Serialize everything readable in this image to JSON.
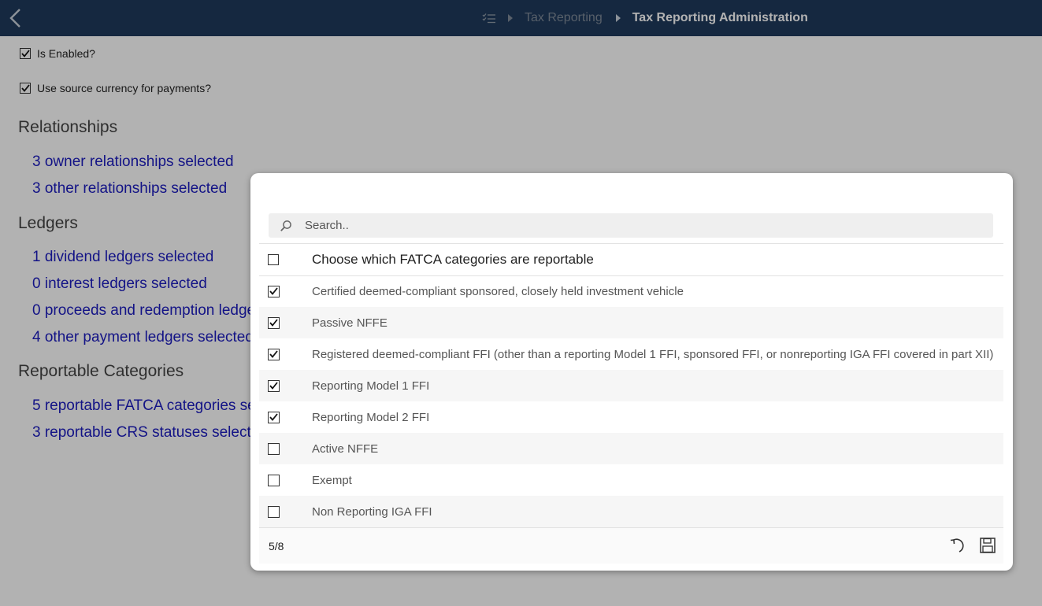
{
  "header": {
    "breadcrumb": [
      "Tax Reporting",
      "Tax Reporting Administration"
    ]
  },
  "settings": {
    "is_enabled": {
      "label": "Is Enabled?",
      "checked": true
    },
    "use_source_currency": {
      "label": "Use source currency for payments?",
      "checked": true
    }
  },
  "sections": {
    "relationships": {
      "title": "Relationships",
      "links": [
        "3 owner relationships selected",
        "3 other relationships selected"
      ]
    },
    "ledgers": {
      "title": "Ledgers",
      "links": [
        "1 dividend ledgers selected",
        "0 interest ledgers selected",
        "0 proceeds and redemption ledgers selected",
        "4 other payment ledgers selected"
      ]
    },
    "reportable_categories": {
      "title": "Reportable Categories",
      "links": [
        "5 reportable FATCA categories selected",
        "3 reportable CRS statuses selected"
      ]
    }
  },
  "modal": {
    "search_placeholder": "Search..",
    "header_label": "Choose which FATCA categories are reportable",
    "items": [
      {
        "label": "Certified deemed-compliant sponsored, closely held investment vehicle",
        "checked": true
      },
      {
        "label": "Passive NFFE",
        "checked": true
      },
      {
        "label": "Registered deemed-compliant FFI (other than a reporting Model 1 FFI, sponsored FFI, or nonreporting IGA FFI covered in part XII)",
        "checked": true
      },
      {
        "label": "Reporting Model 1 FFI",
        "checked": true
      },
      {
        "label": "Reporting Model 2 FFI",
        "checked": true
      },
      {
        "label": "Active NFFE",
        "checked": false
      },
      {
        "label": "Exempt",
        "checked": false
      },
      {
        "label": "Non Reporting IGA FFI",
        "checked": false
      }
    ],
    "count": "5/8"
  },
  "icons": {
    "back": "chevron-left-icon",
    "home": "checklist-icon",
    "search": "search-icon",
    "undo": "undo-icon",
    "save": "save-icon"
  },
  "colors": {
    "topbar": "#1f3a5c",
    "link": "#1c1cc0"
  }
}
